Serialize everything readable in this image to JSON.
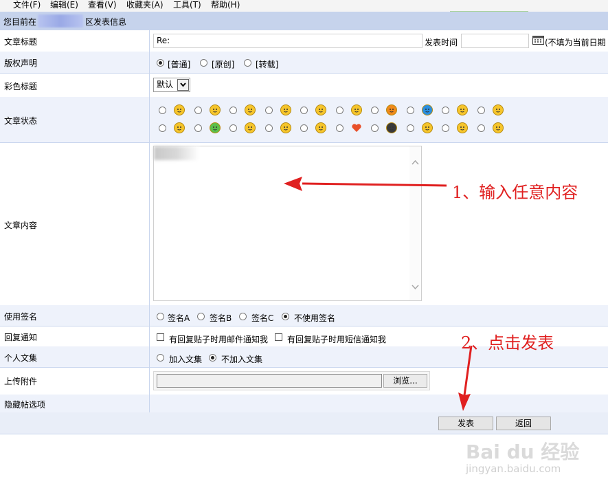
{
  "menu": [
    "文件(F)",
    "编辑(E)",
    "查看(V)",
    "收藏夹(A)",
    "工具(T)",
    "帮助(H)"
  ],
  "header": {
    "prefix": "您目前在",
    "suffix": "区发表信息"
  },
  "title_row": {
    "label": "文章标题",
    "value": "Re:",
    "time_label": "发表时间",
    "time_value": "",
    "time_hint": "(不填为当前日期"
  },
  "copyright_row": {
    "label": "版权声明",
    "options": [
      "[普通]",
      "[原创]",
      "[转载]"
    ],
    "selected": 0
  },
  "color_row": {
    "label": "彩色标题",
    "selected": "默认"
  },
  "status_row": {
    "label": "文章状态",
    "emoticons": [
      "smile",
      "shy",
      "cool",
      "wink",
      "surprised",
      "grin",
      "warning",
      "question",
      "laugh",
      "glasses",
      "angry",
      "sick",
      "dizzy",
      "nerd",
      "arrow",
      "heart",
      "shades",
      "sad",
      "think",
      "silly"
    ]
  },
  "content_row": {
    "label": "文章内容",
    "value": ""
  },
  "signature_row": {
    "label": "使用签名",
    "options": [
      "签名A",
      "签名B",
      "签名C",
      "不使用签名"
    ],
    "selected": 3
  },
  "notify_row": {
    "label": "回复通知",
    "options": [
      "有回复贴子时用邮件通知我",
      "有回复贴子时用短信通知我"
    ]
  },
  "personal_row": {
    "label": "个人文集",
    "options": [
      "加入文集",
      "不加入文集"
    ],
    "selected": 1
  },
  "upload_row": {
    "label": "上传附件",
    "browse": "浏览..."
  },
  "hidden_row": {
    "label": "隐藏帖选项"
  },
  "actions": {
    "submit": "发表",
    "back": "返回"
  },
  "annotations": {
    "step1": "1、输入任意内容",
    "step2": "2、点击发表",
    "color": "#e02020"
  },
  "watermark": {
    "logo": "Bai du 经验",
    "url": "jingyan.baidu.com"
  }
}
